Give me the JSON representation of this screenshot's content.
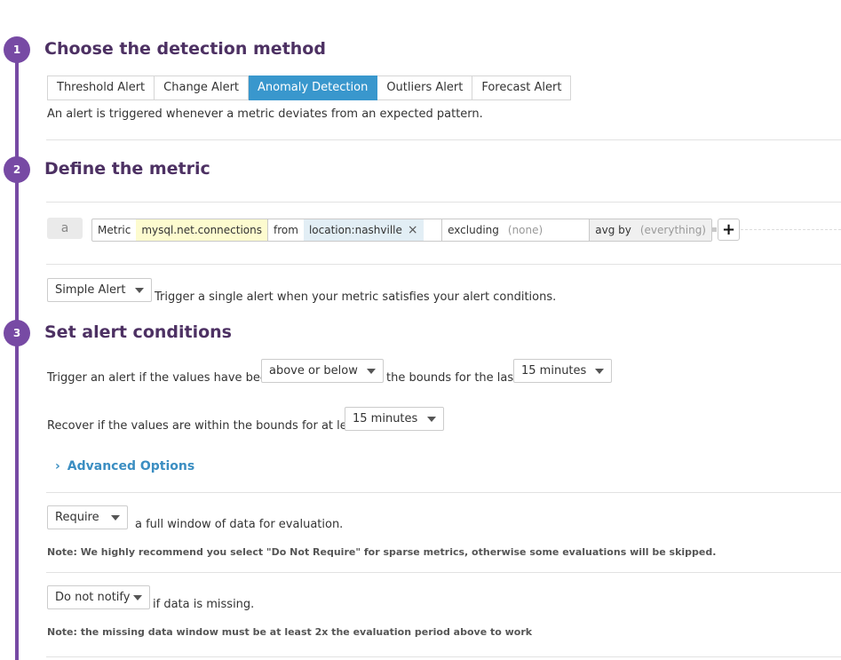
{
  "steps": [
    {
      "number": "1",
      "title": "Choose the detection method"
    },
    {
      "number": "2",
      "title": "Define the metric"
    },
    {
      "number": "3",
      "title": "Set alert conditions"
    }
  ],
  "detection": {
    "tabs": [
      "Threshold Alert",
      "Change Alert",
      "Anomaly Detection",
      "Outliers Alert",
      "Forecast Alert"
    ],
    "active_tab": "Anomaly Detection",
    "description": "An alert is triggered whenever a metric deviates from an expected pattern."
  },
  "query": {
    "letter": "a",
    "metric_label": "Metric",
    "metric_value": "mysql.net.connections",
    "from_label": "from",
    "from_tag": "location:nashville",
    "remove_icon": "×",
    "excluding_label": "excluding",
    "excluding_placeholder": "(none)",
    "avgby_label": "avg by",
    "avgby_placeholder": "(everything)",
    "add_symbol": "+"
  },
  "alert_type": {
    "selected": "Simple Alert",
    "description": "Trigger a single alert when your metric satisfies your alert conditions."
  },
  "conditions": {
    "trigger_prefix": "Trigger an alert if the values have been",
    "bounds_select": "above or below",
    "trigger_middle": "the bounds for the last",
    "trigger_window": "15 minutes",
    "recover_prefix": "Recover if the values are within the bounds for at least",
    "recover_window": "15 minutes",
    "advanced_label": "Advanced Options",
    "require_select": "Require",
    "require_text": "a full window of data for evaluation.",
    "require_note": "Note: We highly recommend you select \"Do Not Require\" for sparse metrics, otherwise some evaluations will be skipped.",
    "notify_select": "Do not notify",
    "notify_text": "if data is missing.",
    "notify_note": "Note: the missing data window must be at least 2x the evaluation period above to work"
  },
  "colors": {
    "step_purple": "#774aa4",
    "title_purple": "#4d3163",
    "active_tab_blue": "#3997cd",
    "link_blue": "#3b8ec2"
  }
}
